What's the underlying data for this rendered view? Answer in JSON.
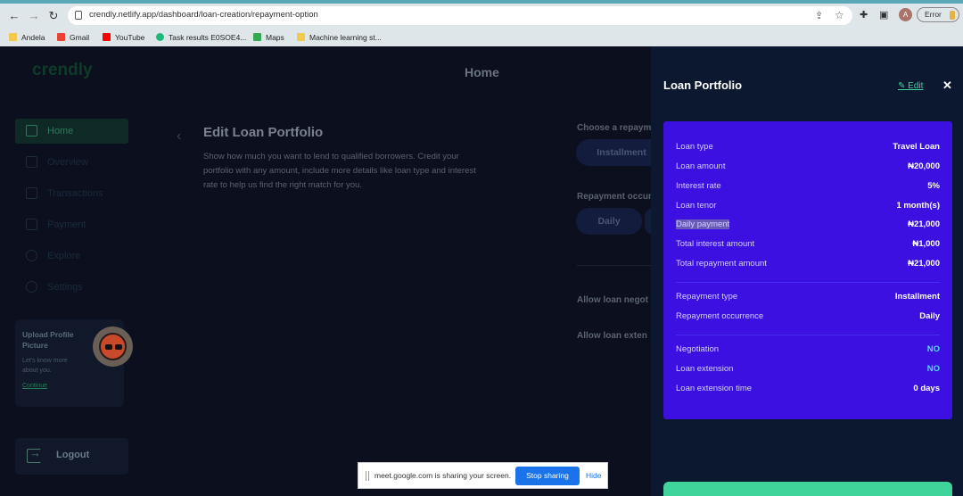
{
  "browser": {
    "url": "crendly.netlify.app/dashboard/loan-creation/repayment-option",
    "avatar_letter": "A",
    "error_label": "Error",
    "bookmarks": [
      {
        "label": "Andela",
        "color": "#f2c94c"
      },
      {
        "label": "Gmail",
        "color": "#ea4335"
      },
      {
        "label": "YouTube",
        "color": "#ff0000"
      },
      {
        "label": "Task results E0SOE4...",
        "color": "#1db97a"
      },
      {
        "label": "Maps",
        "color": "#34a853"
      },
      {
        "label": "Machine learning st...",
        "color": "#f2c94c"
      }
    ]
  },
  "app": {
    "logo": "crendly",
    "page_title": "Home",
    "nav": [
      {
        "label": "Home",
        "icon": "home-icon",
        "active": true
      },
      {
        "label": "Overview",
        "icon": "overview-icon",
        "active": false
      },
      {
        "label": "Transactions",
        "icon": "transactions-icon",
        "active": false
      },
      {
        "label": "Payment",
        "icon": "payment-icon",
        "active": false
      },
      {
        "label": "Explore",
        "icon": "explore-icon",
        "active": false
      },
      {
        "label": "Settings",
        "icon": "settings-icon",
        "active": false
      }
    ],
    "upload_card": {
      "title": "Upload Profile Picture",
      "description": "Let's know more about you.",
      "link": "Continue"
    },
    "logout_label": "Logout",
    "edit_portfolio": {
      "title": "Edit Loan Portfolio",
      "description": "Show how much you want to lend to qualified borrowers. Credit your portfolio with any amount, include more details like loan type and interest rate to help us find the right match for you."
    },
    "repayment_type_label": "Choose a repaym",
    "repayment_type_option": "Installment",
    "repayment_occurrence_label": "Repayment occur",
    "repayment_occurrence_option": "Daily",
    "negotiation_label": "Allow loan negot",
    "extension_label": "Allow loan exten"
  },
  "drawer": {
    "title": "Loan Portfolio",
    "edit_label": "Edit",
    "close_icon": "close-icon",
    "accent_color": "#3b10e0",
    "rows": [
      {
        "key": "Loan type",
        "value": "Travel Loan"
      },
      {
        "key": "Loan amount",
        "value": "₦20,000"
      },
      {
        "key": "Interest rate",
        "value": "5%"
      },
      {
        "key": "Loan tenor",
        "value": "1 month(s)"
      },
      {
        "key": "Daily payment",
        "value": "₦21,000"
      },
      {
        "key": "Total interest amount",
        "value": "₦1,000"
      },
      {
        "key": "Total repayment amount",
        "value": "₦21,000"
      },
      {
        "key": "Repayment type",
        "value": "Installment"
      },
      {
        "key": "Repayment occurrence",
        "value": "Daily"
      },
      {
        "key": "Negotiation",
        "value": "NO"
      },
      {
        "key": "Loan extension",
        "value": "NO"
      },
      {
        "key": "Loan extension time",
        "value": "0 days"
      }
    ]
  },
  "sharebar": {
    "message": "meet.google.com is sharing your screen.",
    "stop_label": "Stop sharing",
    "hide_label": "Hide"
  }
}
